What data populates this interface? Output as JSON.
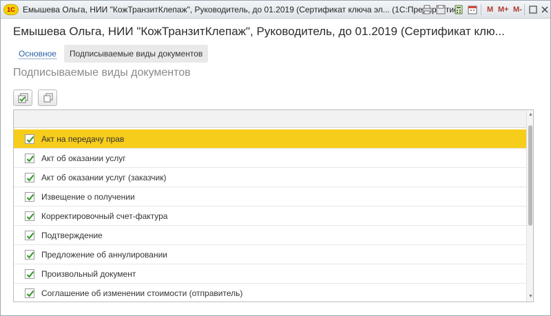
{
  "window": {
    "app_logo": "1С",
    "title": "Емышева Ольга, НИИ \"КожТранзитКлепаж\", Руководитель, до 01.2019 (Сертификат ключа эл...  (1С:Предприятие)",
    "titlebar_buttons": {
      "m": "M",
      "m_plus": "M+",
      "m_minus": "M-"
    }
  },
  "form": {
    "title": "Емышева Ольга, НИИ \"КожТранзитКлепаж\", Руководитель, до 01.2019 (Сертификат клю...",
    "tabs": [
      {
        "label": "Основное"
      },
      {
        "label": "Подписываемые виды документов"
      }
    ],
    "section_title": "Подписываемые виды документов"
  },
  "table": {
    "rows": [
      {
        "label": "Акт на передачу прав",
        "checked": true,
        "selected": true
      },
      {
        "label": "Акт об оказании услуг",
        "checked": true,
        "selected": false
      },
      {
        "label": "Акт об оказании услуг (заказчик)",
        "checked": true,
        "selected": false
      },
      {
        "label": "Извещение о получении",
        "checked": true,
        "selected": false
      },
      {
        "label": "Корректировочный счет-фактура",
        "checked": true,
        "selected": false
      },
      {
        "label": "Подтверждение",
        "checked": true,
        "selected": false
      },
      {
        "label": "Предложение об аннулировании",
        "checked": true,
        "selected": false
      },
      {
        "label": "Произвольный документ",
        "checked": true,
        "selected": false
      },
      {
        "label": "Соглашение об изменении стоимости (отправитель)",
        "checked": true,
        "selected": false
      }
    ]
  },
  "colors": {
    "selected_row": "#f7cd1c",
    "checkmark": "#3a9a2e",
    "link": "#2a5fa8"
  }
}
